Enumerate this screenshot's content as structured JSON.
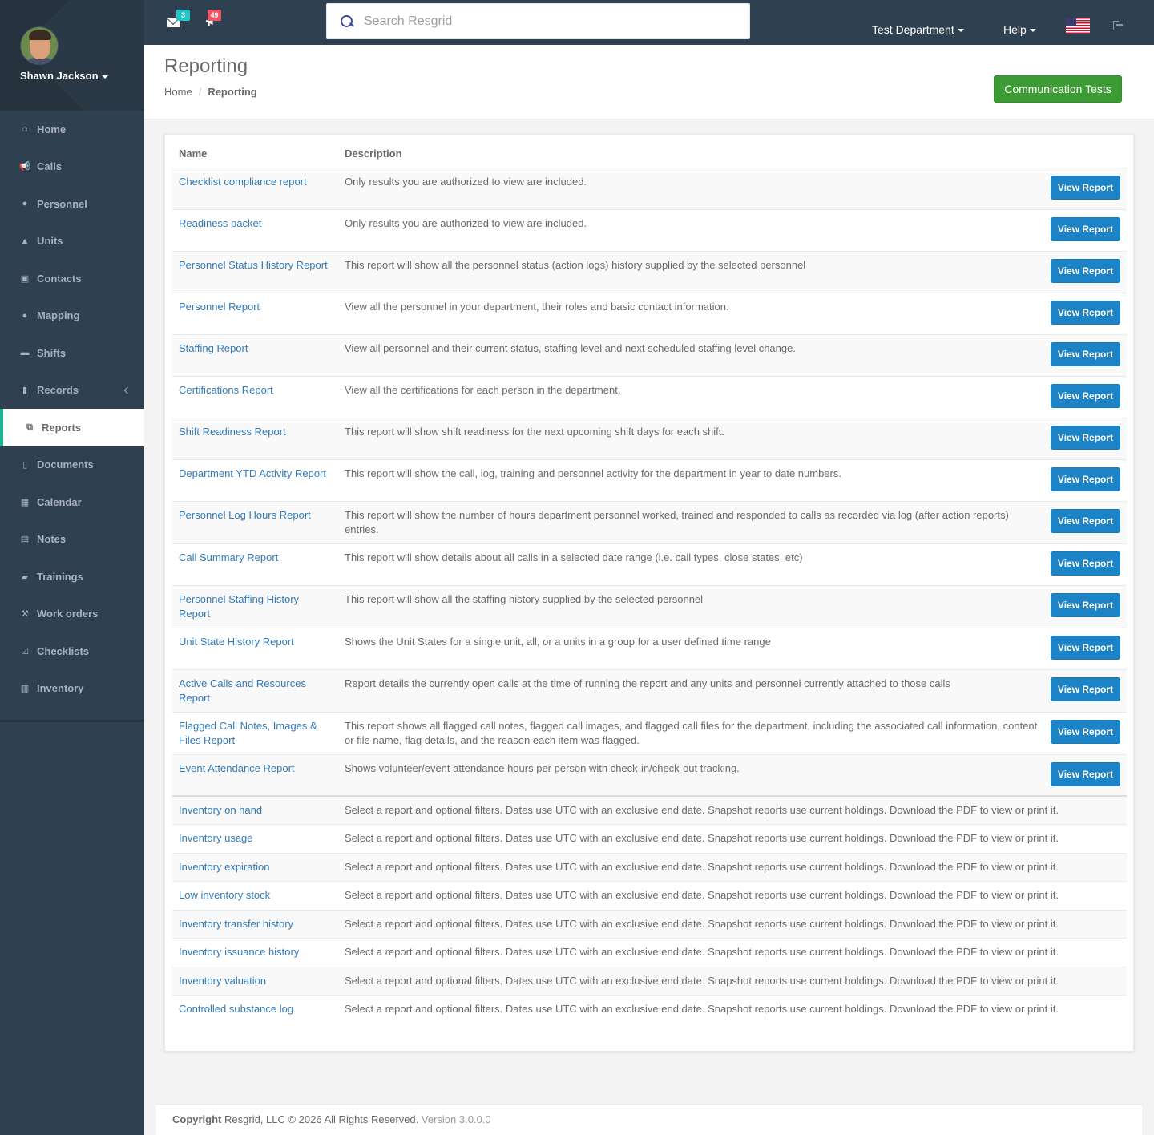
{
  "user": {
    "name": "Shawn Jackson"
  },
  "nav": {
    "items": [
      {
        "label": "Home",
        "icon": "home-icon",
        "glyph": "⌂"
      },
      {
        "label": "Calls",
        "icon": "bullhorn-icon",
        "glyph": "📢"
      },
      {
        "label": "Personnel",
        "icon": "user-icon",
        "glyph": "●"
      },
      {
        "label": "Units",
        "icon": "truck-icon",
        "glyph": "▲"
      },
      {
        "label": "Contacts",
        "icon": "address-book-icon",
        "glyph": "▣"
      },
      {
        "label": "Mapping",
        "icon": "map-marker-icon",
        "glyph": "●"
      },
      {
        "label": "Shifts",
        "icon": "shifts-icon",
        "glyph": "▬"
      },
      {
        "label": "Records",
        "icon": "file-icon",
        "glyph": "▮"
      },
      {
        "label": "Reports",
        "icon": "reports-icon",
        "glyph": "⧉"
      },
      {
        "label": "Documents",
        "icon": "document-icon",
        "glyph": "▯"
      },
      {
        "label": "Calendar",
        "icon": "calendar-icon",
        "glyph": "▦"
      },
      {
        "label": "Notes",
        "icon": "notes-icon",
        "glyph": "▤"
      },
      {
        "label": "Trainings",
        "icon": "book-icon",
        "glyph": "▰"
      },
      {
        "label": "Work orders",
        "icon": "wrench-icon",
        "glyph": "⚒"
      },
      {
        "label": "Checklists",
        "icon": "checklist-icon",
        "glyph": "☑"
      },
      {
        "label": "Inventory",
        "icon": "barcode-icon",
        "glyph": "▥"
      }
    ]
  },
  "topbar": {
    "messages_count": "3",
    "notifications_count": "49",
    "search_placeholder": "Search Resgrid",
    "department": "Test Department",
    "help": "Help"
  },
  "header": {
    "title": "Reporting",
    "breadcrumb_home": "Home",
    "breadcrumb_current": "Reporting",
    "action_button": "Communication Tests"
  },
  "table": {
    "col_name": "Name",
    "col_description": "Description",
    "button_label": "View Report",
    "reports": [
      {
        "name": "Checklist compliance report",
        "description": "Only results you are authorized to view are included."
      },
      {
        "name": "Readiness packet",
        "description": "Only results you are authorized to view are included."
      },
      {
        "name": "Personnel Status History Report",
        "description": "This report will show all the personnel status (action logs) history supplied by the selected personnel"
      },
      {
        "name": "Personnel Report",
        "description": "View all the personnel in your department, their roles and basic contact information."
      },
      {
        "name": "Staffing Report",
        "description": "View all personnel and their current status, staffing level and next scheduled staffing level change."
      },
      {
        "name": "Certifications Report",
        "description": "View all the certifications for each person in the department."
      },
      {
        "name": "Shift Readiness Report",
        "description": "This report will show shift readiness for the next upcoming shift days for each shift."
      },
      {
        "name": "Department YTD Activity Report",
        "description": "This report will show the call, log, training and personnel activity for the department in year to date numbers."
      },
      {
        "name": "Personnel Log Hours Report",
        "description": "This report will show the number of hours department personnel worked, trained and responded to calls as recorded via log (after action reports) entries."
      },
      {
        "name": "Call Summary Report",
        "description": "This report will show details about all calls in a selected date range (i.e. call types, close states, etc)"
      },
      {
        "name": "Personnel Staffing History Report",
        "description": "This report will show all the staffing history supplied by the selected personnel"
      },
      {
        "name": "Unit State History Report",
        "description": "Shows the Unit States for a single unit, all, or a units in a group for a user defined time range"
      },
      {
        "name": "Active Calls and Resources Report",
        "description": "Report details the currently open calls at the time of running the report and any units and personnel currently attached to those calls"
      },
      {
        "name": "Flagged Call Notes, Images & Files Report",
        "description": "This report shows all flagged call notes, flagged call images, and flagged call files for the department, including the associated call information, content or file name, flag details, and the reason each item was flagged."
      },
      {
        "name": "Event Attendance Report",
        "description": "Shows volunteer/event attendance hours per person with check-in/check-out tracking."
      }
    ],
    "inventory_description": "Select a report and optional filters. Dates use UTC with an exclusive end date. Snapshot reports use current holdings. Download the PDF to view or print it.",
    "inventory_reports": [
      "Inventory on hand",
      "Inventory usage",
      "Inventory expiration",
      "Low inventory stock",
      "Inventory transfer history",
      "Inventory issuance history",
      "Inventory valuation",
      "Controlled substance log"
    ]
  },
  "footer": {
    "copyright_label": "Copyright",
    "copyright_text": "Resgrid, LLC © 2026 All Rights Reserved.",
    "version": "Version 3.0.0.0"
  },
  "colors": {
    "sidebar": "#2f4050",
    "accent_green": "#3d9b35",
    "button_blue": "#1c84c6",
    "link_blue": "#337ab7"
  }
}
